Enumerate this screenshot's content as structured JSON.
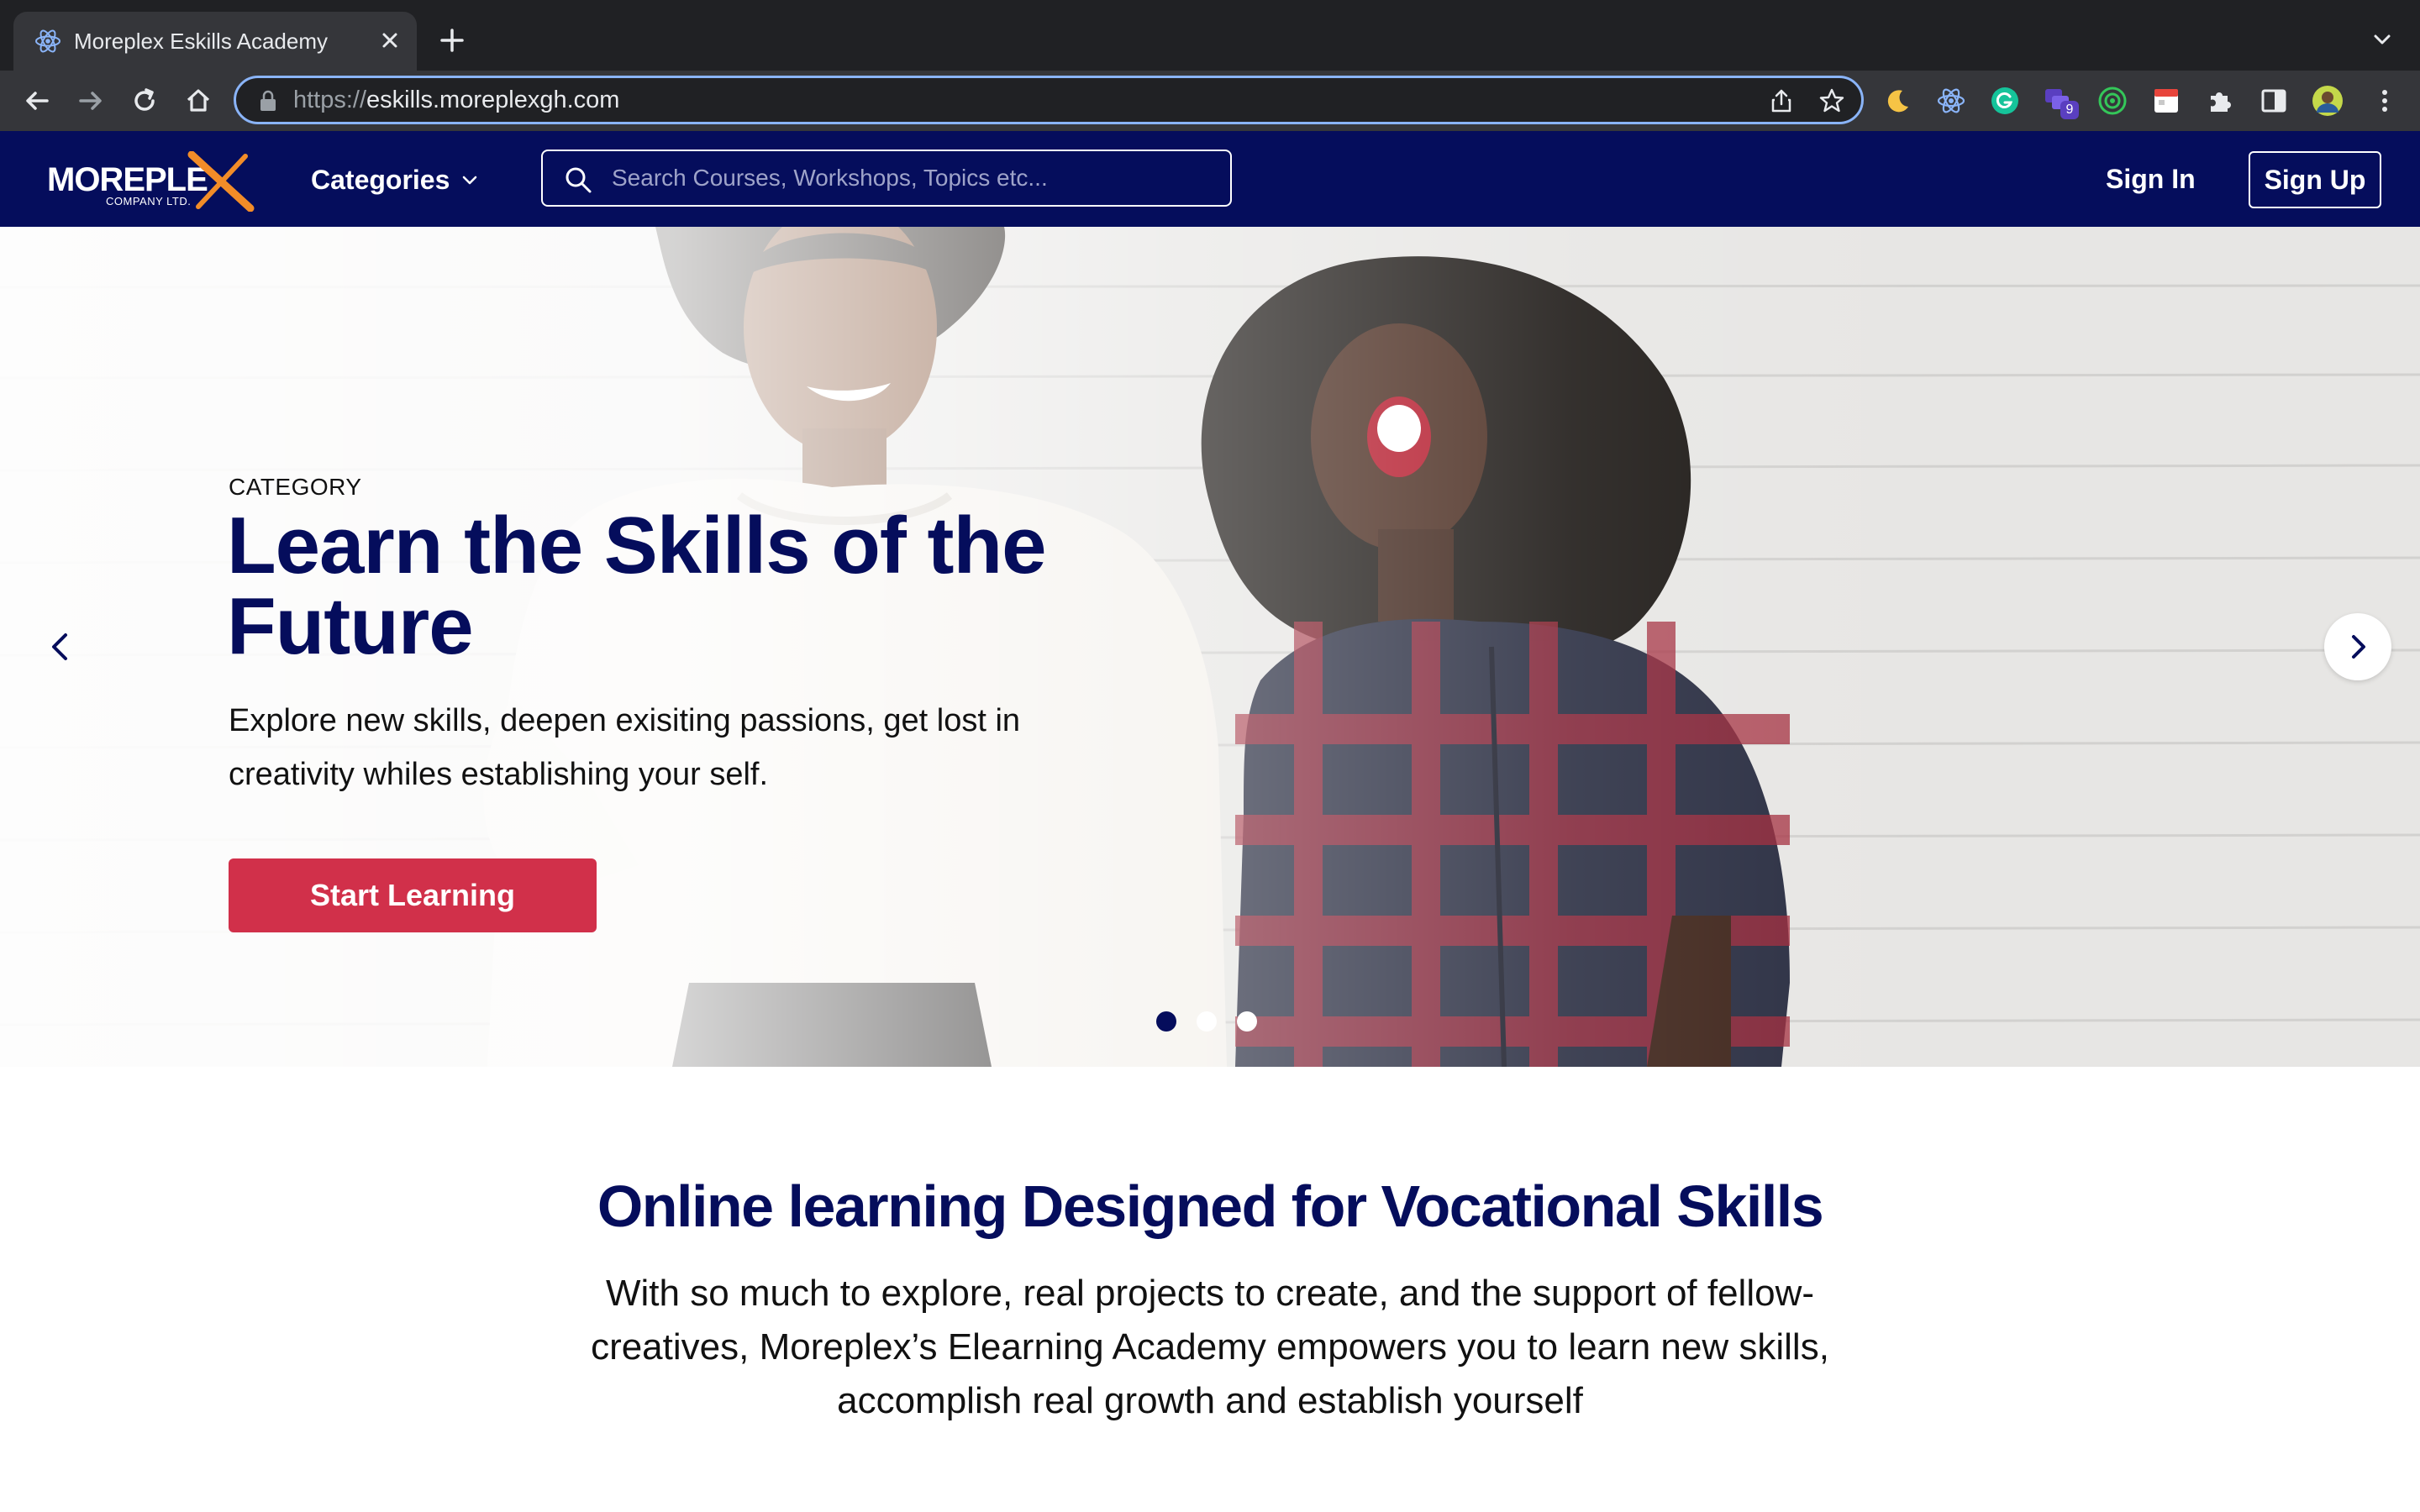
{
  "browser": {
    "tab_title": "Moreplex Eskills Academy",
    "url_scheme": "https://",
    "url_host": "eskills.moreplexgh.com",
    "extension_badge": "9"
  },
  "header": {
    "logo_text": "MOREPLE",
    "logo_sub": "COMPANY LTD.",
    "categories_label": "Categories",
    "search_placeholder": "Search Courses, Workshops, Topics etc...",
    "sign_in": "Sign In",
    "sign_up": "Sign Up"
  },
  "hero": {
    "category": "CATEGORY",
    "title": "Learn the Skills of the Future",
    "description": "Explore new skills, deepen exisiting passions, get lost in creativity whiles establishing your self.",
    "cta": "Start Learning",
    "slide_count": 3,
    "active_slide": 1
  },
  "intro": {
    "title": "Online learning Designed for Vocational Skills",
    "body": "With so much to explore, real projects to create, and the support of fellow-creatives, Moreplex’s Elearning Academy empowers you to learn new skills, accomplish real growth and establish yourself"
  },
  "colors": {
    "brand_navy": "#050d5c",
    "cta_red": "#d1304a",
    "logo_orange": "#f28c28"
  }
}
